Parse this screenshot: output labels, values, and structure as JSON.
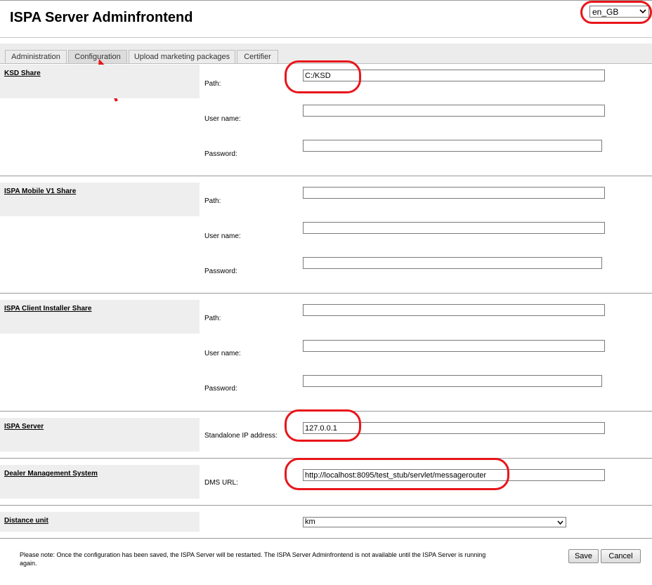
{
  "header": {
    "title": "ISPA Server Adminfrontend"
  },
  "language": {
    "selected": "en_GB"
  },
  "tabs": [
    {
      "label": "Administration",
      "active": false
    },
    {
      "label": "Configuration",
      "active": true
    },
    {
      "label": "Upload marketing packages",
      "active": false
    },
    {
      "label": "Certifier",
      "active": false
    }
  ],
  "sections": {
    "ksd": {
      "title": "KSD Share",
      "path_label": "Path:",
      "path_value": "C:/KSD",
      "user_label": "User name:",
      "user_value": "",
      "password_label": "Password:",
      "password_value": ""
    },
    "mobile": {
      "title": "ISPA Mobile V1 Share",
      "path_label": "Path:",
      "path_value": "",
      "user_label": "User name:",
      "user_value": "",
      "password_label": "Password:",
      "password_value": ""
    },
    "client": {
      "title": "ISPA Client Installer Share",
      "path_label": "Path:",
      "path_value": "",
      "user_label": "User name:",
      "user_value": "",
      "password_label": "Password:",
      "password_value": ""
    },
    "server": {
      "title": "ISPA Server",
      "ip_label": "Standalone IP address:",
      "ip_value": "127.0.0.1"
    },
    "dms": {
      "title": "Dealer Management System",
      "url_label": "DMS URL:",
      "url_value": "http://localhost:8095/test_stub/servlet/messagerouter"
    },
    "distance": {
      "title": "Distance unit",
      "selected": "km"
    }
  },
  "footer": {
    "note": "Please note: Once the configuration has been saved, the ISPA Server will be restarted. The ISPA Server Adminfrontend is not available until the ISPA Server is running again.",
    "save_label": "Save",
    "cancel_label": "Cancel"
  },
  "colors": {
    "annotation": "#e8151a",
    "section_bg": "#eeeeee"
  }
}
